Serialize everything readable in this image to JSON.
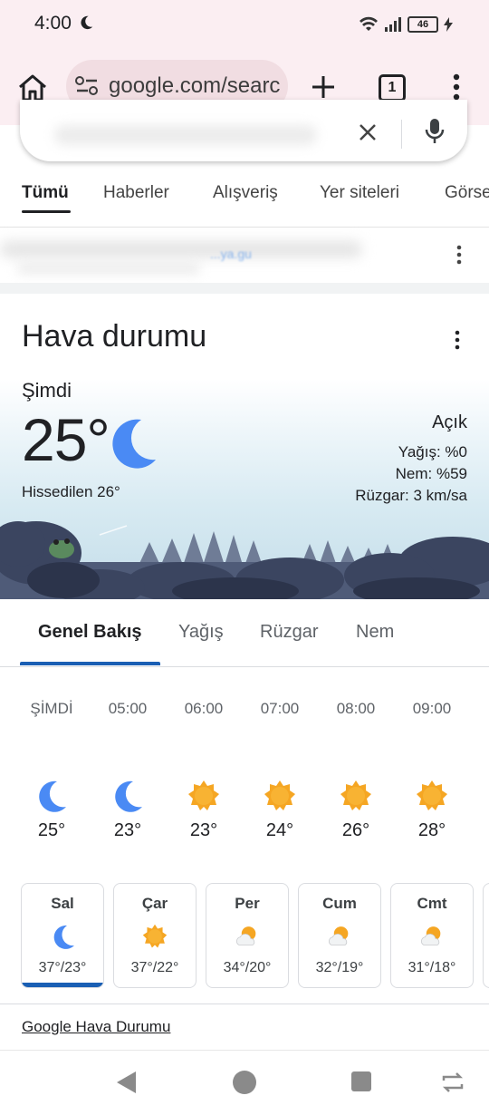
{
  "status": {
    "time": "4:00",
    "battery": "46"
  },
  "browser": {
    "url": "google.com/searc",
    "tab_count": "1"
  },
  "search_tabs": [
    "Tümü",
    "Haberler",
    "Alışveriş",
    "Yer siteleri",
    "Görse"
  ],
  "blurred_link": "...ya.gu",
  "weather": {
    "title": "Hava durumu",
    "now_label": "Şimdi",
    "temperature": "25°",
    "feels_like": "Hissedilen 26°",
    "condition": "Açık",
    "precipitation": "Yağış: %0",
    "humidity": "Nem: %59",
    "wind": "Rüzgar: 3 km/sa"
  },
  "weather_tabs": [
    "Genel Bakış",
    "Yağış",
    "Rüzgar",
    "Nem"
  ],
  "hourly": [
    {
      "time": "ŞİMDİ",
      "icon": "moon-icon",
      "temp": "25°"
    },
    {
      "time": "05:00",
      "icon": "moon-icon",
      "temp": "23°"
    },
    {
      "time": "06:00",
      "icon": "sun-icon",
      "temp": "23°"
    },
    {
      "time": "07:00",
      "icon": "sun-icon",
      "temp": "24°"
    },
    {
      "time": "08:00",
      "icon": "sun-icon",
      "temp": "26°"
    },
    {
      "time": "09:00",
      "icon": "sun-icon",
      "temp": "28°"
    }
  ],
  "daily": [
    {
      "day": "Sal",
      "icon": "moon-icon",
      "temps": "37°/23°"
    },
    {
      "day": "Çar",
      "icon": "sun-icon",
      "temps": "37°/22°"
    },
    {
      "day": "Per",
      "icon": "partly-cloudy-icon",
      "temps": "34°/20°"
    },
    {
      "day": "Cum",
      "icon": "partly-cloudy-icon",
      "temps": "32°/19°"
    },
    {
      "day": "Cmt",
      "icon": "partly-cloudy-icon",
      "temps": "31°/18°"
    }
  ],
  "source_link": "Google Hava Durumu",
  "colors": {
    "accent": "#1a5fb4",
    "moon": "#4a8af4",
    "sun": "#f5a623",
    "chrome_bg": "#fbeef2"
  }
}
